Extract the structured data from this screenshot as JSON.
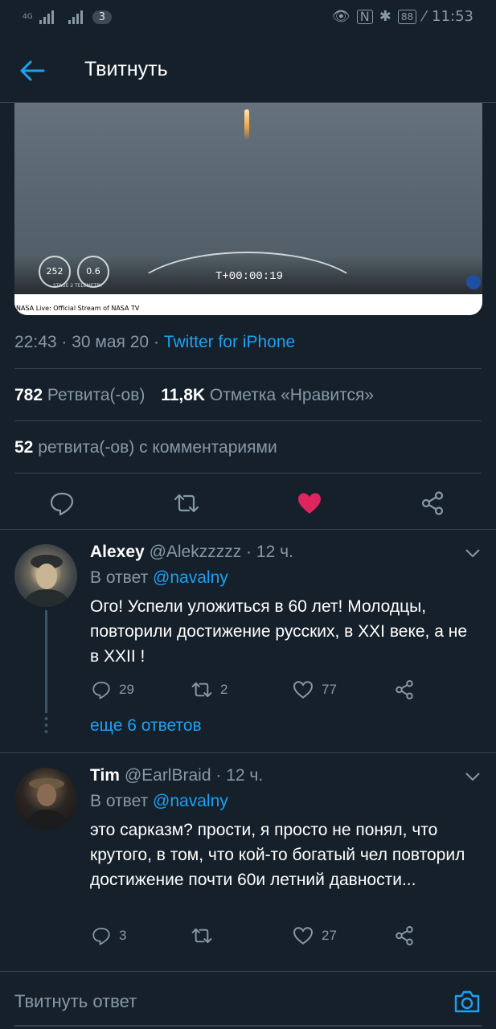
{
  "status_bar": {
    "network": "4G",
    "notifications_count": "3",
    "battery": "88",
    "time": "11:53"
  },
  "header": {
    "title": "Твитнуть"
  },
  "media": {
    "caption": "NASA Live: Official Stream of NASA TV",
    "countdown": "T+00:00:19",
    "speed_value": "252",
    "altitude_value": "0.6",
    "telemetry_label": "STAGE 2 TELEMETRY"
  },
  "tweet": {
    "time": "22:43",
    "date": "30 мая 20",
    "source": "Twitter for iPhone",
    "retweets_count": "782",
    "retweets_label": "Ретвита(-ов)",
    "likes_count": "11,8K",
    "likes_label": "Отметка «Нравится»",
    "quote_count": "52",
    "quote_label": "ретвита(-ов) с комментариями",
    "liked": true
  },
  "replies": [
    {
      "name": "Alexey",
      "handle": "@Alekzzzzz",
      "age": "12 ч.",
      "reply_to_prefix": "В ответ",
      "reply_to": "@navalny",
      "text": "Ого! Успели уложиться в 60 лет! Молодцы, повторили достижение русских, в XXI веке, а не в XXII !",
      "replies": "29",
      "retweets": "2",
      "likes": "77",
      "more_label": "еще 6 ответов"
    },
    {
      "name": "Tim",
      "handle": "@EarlBraid",
      "age": "12 ч.",
      "reply_to_prefix": "В ответ",
      "reply_to": "@navalny",
      "text": "это сарказм? прости, я просто не понял, что крутого, в том, что кой-то богатый чел повторил достижение почти 60и летний давности...",
      "replies": "3",
      "retweets": "",
      "likes": "27"
    }
  ],
  "composer": {
    "placeholder": "Твитнуть ответ"
  },
  "colors": {
    "background": "#15202b",
    "accent": "#1da1f2",
    "like": "#e0245e",
    "muted": "#8899a6"
  }
}
